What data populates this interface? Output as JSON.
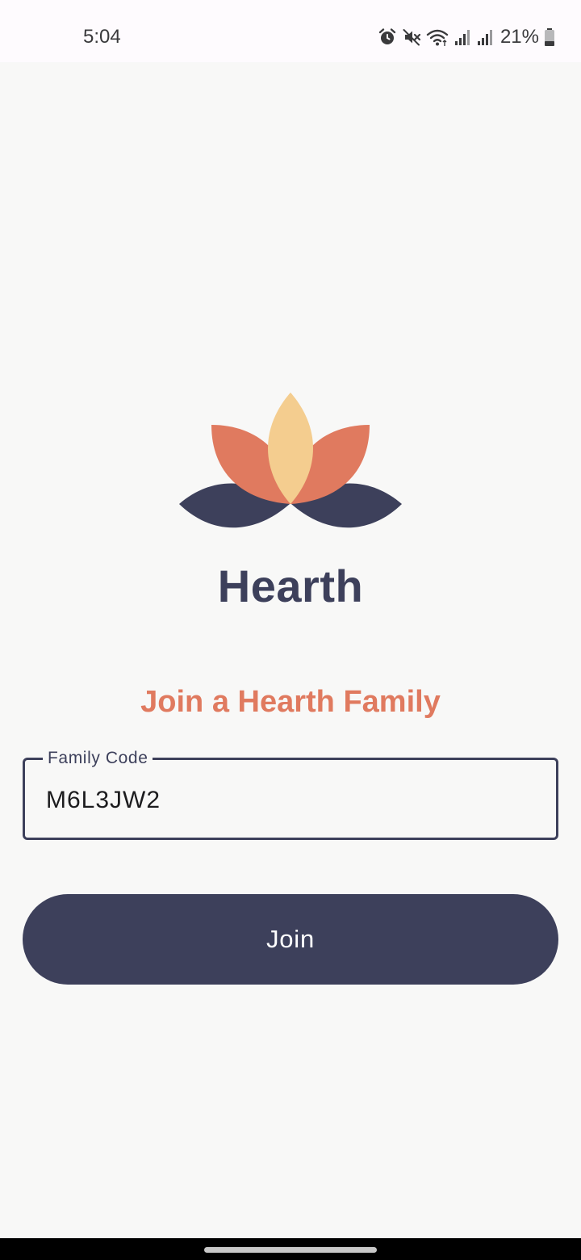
{
  "status_bar": {
    "time": "5:04",
    "battery_percent": "21%",
    "icons": [
      "alarm-icon",
      "mute-icon",
      "wifi-icon",
      "signal-icon",
      "signal-icon",
      "battery-icon"
    ]
  },
  "brand": {
    "name": "Hearth",
    "logo_icon": "lotus-icon",
    "colors": {
      "navy": "#3d405b",
      "coral": "#e07a5f",
      "yellow": "#f4cd8f"
    }
  },
  "join_form": {
    "title": "Join a Hearth Family",
    "family_code_label": "Family Code",
    "family_code_value": "M6L3JW2",
    "join_button_label": "Join"
  }
}
